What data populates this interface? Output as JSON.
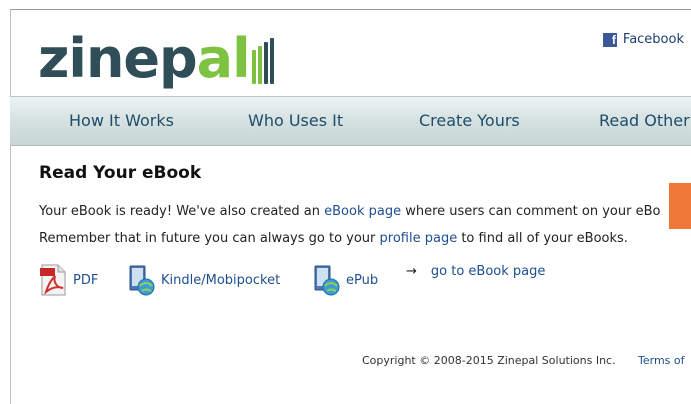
{
  "header": {
    "logo_dark": "zinep",
    "logo_green": "al",
    "facebook_label": "Facebook",
    "facebook_icon": "facebook-icon"
  },
  "nav": {
    "items": [
      {
        "label": "How It Works"
      },
      {
        "label": "Who Uses It"
      },
      {
        "label": "Create Yours"
      },
      {
        "label": "Read Other"
      }
    ]
  },
  "main": {
    "title": "Read Your eBook",
    "line1_before": "Your eBook is ready! We've also created an ",
    "line1_link": "eBook page",
    "line1_after": " where users can comment on your eBo",
    "line2_before": "Remember that in future you can always go to your ",
    "line2_link": "profile page",
    "line2_after": " to find all of your eBooks.",
    "downloads": [
      {
        "label": "PDF",
        "icon": "pdf-file-icon"
      },
      {
        "label": "Kindle/Mobipocket",
        "icon": "kindle-book-icon"
      },
      {
        "label": "ePub",
        "icon": "epub-book-icon"
      }
    ],
    "goto_arrow": "→",
    "goto_label": "go to eBook page"
  },
  "footer": {
    "copyright": "Copyright © 2008-2015 Zinepal Solutions Inc.",
    "terms": "Terms of"
  },
  "colors": {
    "brand_dark": "#2f4e57",
    "brand_green": "#7ec242",
    "link": "#1e4f8f",
    "nav_text": "#1d4d6a",
    "accent_orange": "#f07836"
  }
}
